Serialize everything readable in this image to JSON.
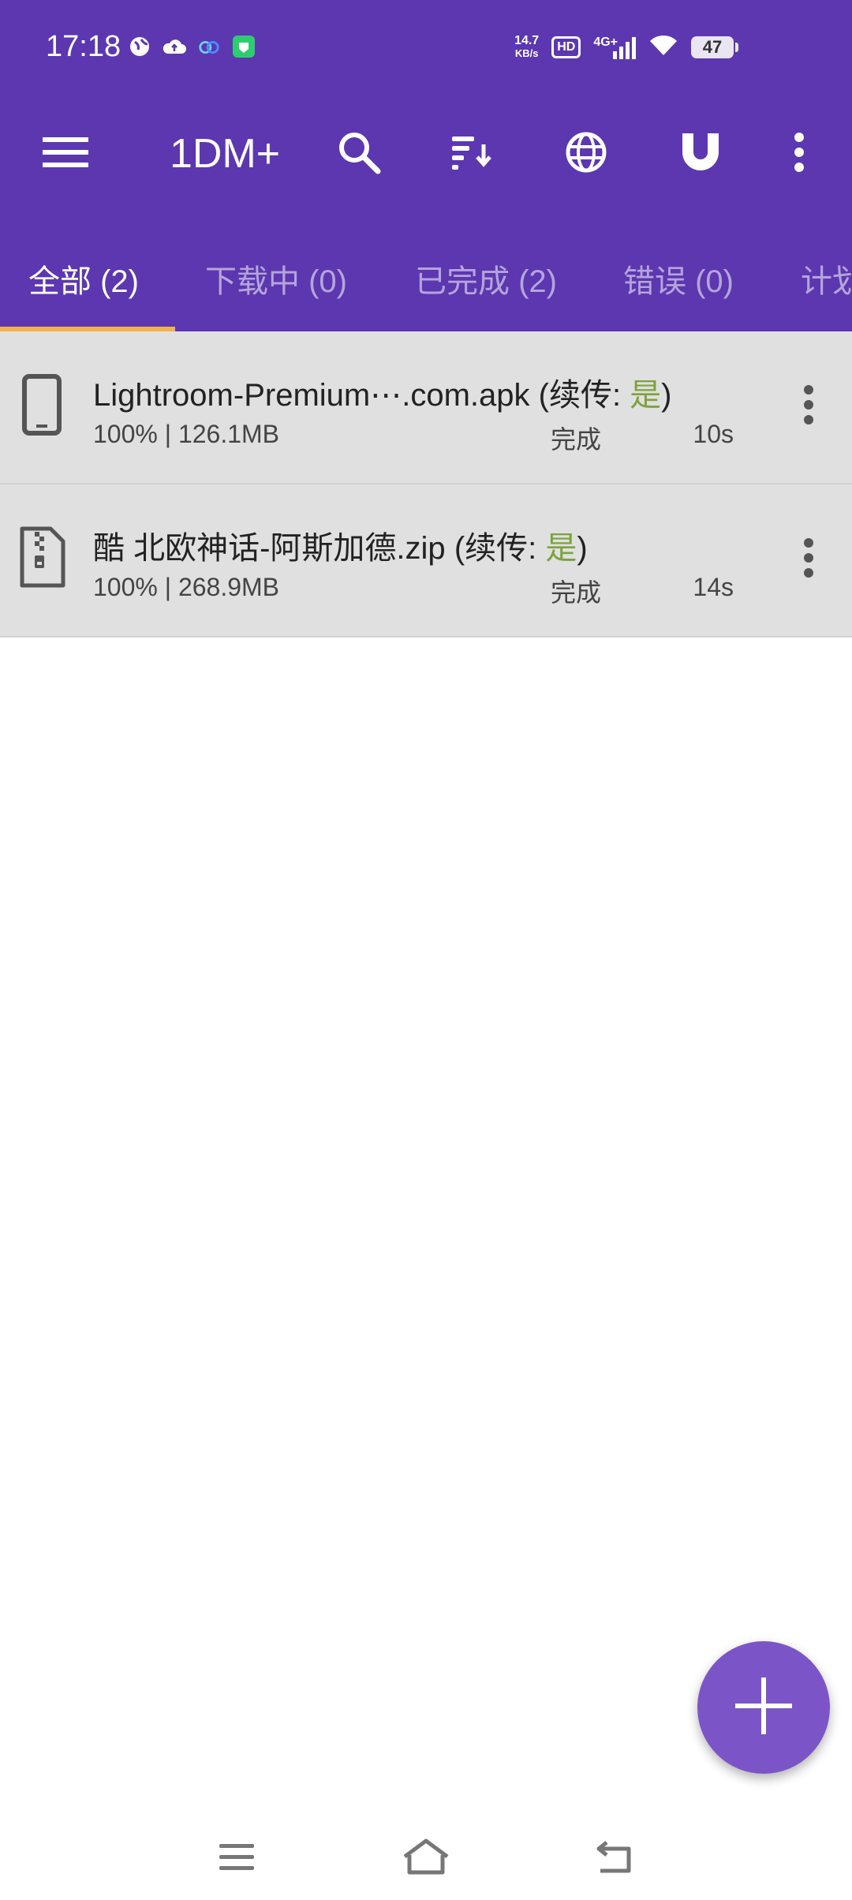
{
  "status_bar": {
    "time": "17:18",
    "net_speed_value": "14.7",
    "net_speed_unit": "KB/s",
    "hd_label": "HD",
    "network_type": "4G+",
    "battery_level": "47"
  },
  "toolbar": {
    "title": "1DM+"
  },
  "tabs": [
    {
      "label": "全部 (2)",
      "active": true
    },
    {
      "label": "下载中 (0)",
      "active": false
    },
    {
      "label": "已完成 (2)",
      "active": false
    },
    {
      "label": "错误 (0)",
      "active": false
    },
    {
      "label": "计划",
      "active": false
    }
  ],
  "downloads": [
    {
      "filename": "Lightroom-Premium⋯.com.apk",
      "resume_prefix": "(续传: ",
      "resume_value": "是",
      "resume_suffix": ")",
      "meta": "100% | 126.1MB",
      "state": "完成",
      "elapsed": "10s",
      "icon": "phone-icon"
    },
    {
      "filename": "酷 北欧神话-阿斯加德.zip",
      "resume_prefix": "(续传: ",
      "resume_value": "是",
      "resume_suffix": ")",
      "meta": "100% | 268.9MB",
      "state": "完成",
      "elapsed": "14s",
      "icon": "zip-file-icon"
    }
  ],
  "colors": {
    "primary": "#5c37b0",
    "accent_indicator": "#f2b24c",
    "fab": "#7b55c8",
    "resume_yes": "#7da23c",
    "row_bg": "#e0e0e0"
  }
}
